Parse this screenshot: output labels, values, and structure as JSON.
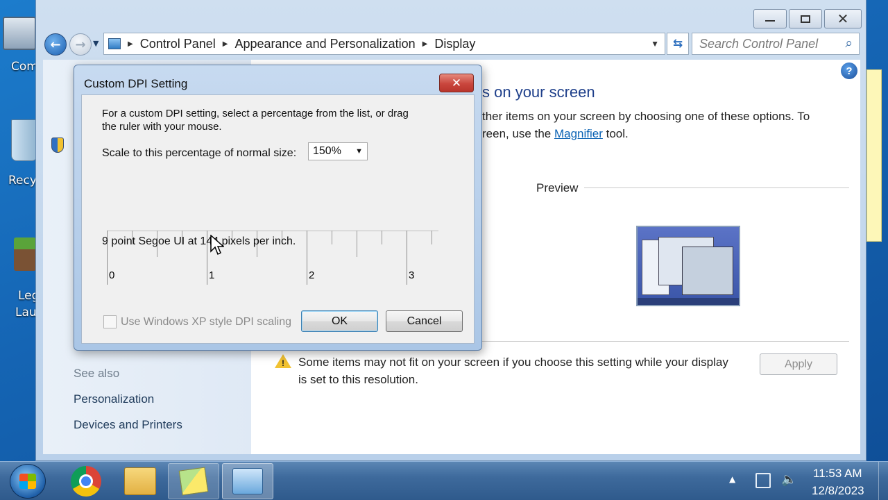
{
  "desktop": {
    "icons": [
      {
        "name": "computer",
        "label": "Com"
      },
      {
        "name": "recycle-bin",
        "label": "Recy"
      },
      {
        "name": "legacy-launcher",
        "label_line1": "Leg",
        "label_line2": "Lau"
      }
    ]
  },
  "window": {
    "address": {
      "crumbs": [
        "Control Panel",
        "Appearance and Personalization",
        "Display"
      ]
    },
    "search_placeholder": "Search Control Panel",
    "left_pane": {
      "see_also": "See also",
      "links": [
        "Personalization",
        "Devices and Printers"
      ]
    },
    "main": {
      "heading_fragment": "s on your screen",
      "desc_line1": "ther items on your screen by choosing one of these options. To",
      "desc_line2_prefix": "reen, use the ",
      "desc_link": "Magnifier",
      "desc_line2_suffix": " tool.",
      "preview_label": "Preview",
      "warning_line1": "Some items may not fit on your screen if you choose this setting while your display",
      "warning_line2": "is set to this resolution.",
      "apply_label": "Apply"
    }
  },
  "dialog": {
    "title": "Custom DPI Setting",
    "instructions_line1": "For a custom DPI setting, select a percentage from the list, or drag",
    "instructions_line2": "the ruler with your mouse.",
    "scale_label": "Scale to this percentage of normal size:",
    "scale_value": "150%",
    "ruler_labels": [
      "0",
      "1",
      "2",
      "3"
    ],
    "sample_text": "9 point Segoe UI at 144 pixels per inch.",
    "xp_checkbox_label": "Use Windows XP style DPI scaling",
    "xp_checkbox_checked": false,
    "ok_label": "OK",
    "cancel_label": "Cancel"
  },
  "taskbar": {
    "apps": [
      "chrome",
      "file-explorer",
      "sticky-notes",
      "control-panel"
    ],
    "time": "11:53 AM",
    "date": "12/8/2023"
  },
  "colors": {
    "link": "#0b63b4",
    "heading": "#1e3f8a",
    "close_red": "#c9463d"
  }
}
